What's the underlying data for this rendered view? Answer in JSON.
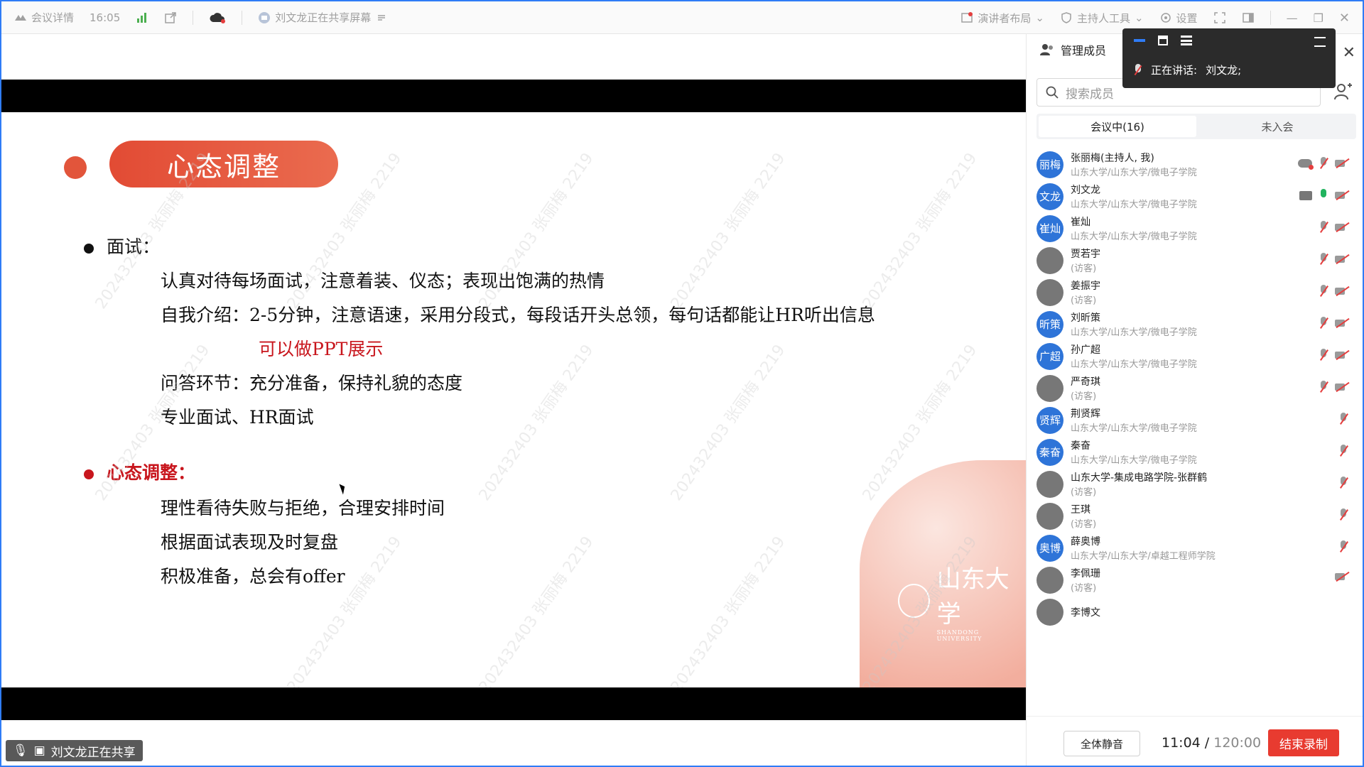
{
  "topbar": {
    "meeting_details": "会议详情",
    "time": "16:05",
    "sharing_status": "刘文龙正在共享屏幕",
    "presenter_layout": "演讲者布局",
    "host_tools": "主持人工具",
    "settings": "设置"
  },
  "slide": {
    "title": "心态调整",
    "bullet1": "面试：",
    "lines1": [
      "认真对待每场面试，注意着装、仪态；表现出饱满的热情",
      "自我介绍：2-5分钟，注意语速，采用分段式，每段话开头总领，每句话都能让HR听出信息",
      "可以做PPT展示",
      "问答环节：充分准备，保持礼貌的态度",
      "专业面试、HR面试"
    ],
    "bullet2": "心态调整：",
    "lines2": [
      "理性看待失败与拒绝，合理安排时间",
      "根据面试表现及时复盘",
      "积极准备，总会有offer"
    ],
    "watermark": "202432403 张丽梅 2219",
    "logo_text": "山东大学",
    "logo_sub": "SHANDONG UNIVERSITY"
  },
  "share_tag": "刘文龙正在共享",
  "panel": {
    "title": "管理成员",
    "search_placeholder": "搜索成员",
    "tab_in_meeting": "会议中(16)",
    "tab_not_joined": "未入会",
    "members": [
      {
        "avatar": "丽梅",
        "name": "张丽梅(主持人, 我)",
        "org": "山东大学/山东大学/微电子学院",
        "mic": "off",
        "cam": "off",
        "cloud": true
      },
      {
        "avatar": "文龙",
        "name": "刘文龙",
        "org": "山东大学/山东大学/微电子学院",
        "mic": "on",
        "cam": "off",
        "screen": true
      },
      {
        "avatar": "崔灿",
        "name": "崔灿",
        "org": "山东大学/山东大学/微电子学院",
        "mic": "off",
        "cam": "off"
      },
      {
        "avatar": "",
        "name": "贾若宇",
        "org": "(访客)",
        "mic": "off",
        "cam": "off",
        "photo": true
      },
      {
        "avatar": "",
        "name": "姜振宇",
        "org": "(访客)",
        "mic": "off",
        "cam": "off",
        "photo": true
      },
      {
        "avatar": "昕策",
        "name": "刘昕策",
        "org": "山东大学/山东大学/微电子学院",
        "mic": "off",
        "cam": "off"
      },
      {
        "avatar": "广超",
        "name": "孙广超",
        "org": "山东大学/山东大学/微电子学院",
        "mic": "off",
        "cam": "off"
      },
      {
        "avatar": "",
        "name": "严奇琪",
        "org": "(访客)",
        "mic": "off",
        "cam": "off",
        "photo": true
      },
      {
        "avatar": "贤辉",
        "name": "荆贤辉",
        "org": "山东大学/山东大学/微电子学院",
        "mic": "off"
      },
      {
        "avatar": "秦奋",
        "name": "秦奋",
        "org": "山东大学/山东大学/微电子学院",
        "mic": "off"
      },
      {
        "avatar": "",
        "name": "山东大学-集成电路学院-张群鹤",
        "org": "(访客)",
        "mic": "off",
        "photo": true
      },
      {
        "avatar": "",
        "name": "王琪",
        "org": "(访客)",
        "mic": "off",
        "photo": true
      },
      {
        "avatar": "奥博",
        "name": "薛奥博",
        "org": "山东大学/山东大学/卓越工程师学院",
        "mic": "off"
      },
      {
        "avatar": "",
        "name": "李佩珊",
        "org": "(访客)",
        "cam": "off",
        "photo": true
      },
      {
        "avatar": "",
        "name": "李博文",
        "org": "",
        "photo": true
      }
    ],
    "mute_all": "全体静音",
    "timer_elapsed": "11:04",
    "timer_total": "120:00",
    "end_recording": "结束录制"
  },
  "speaking": {
    "label": "正在讲话:",
    "speaker": "刘文龙;"
  }
}
